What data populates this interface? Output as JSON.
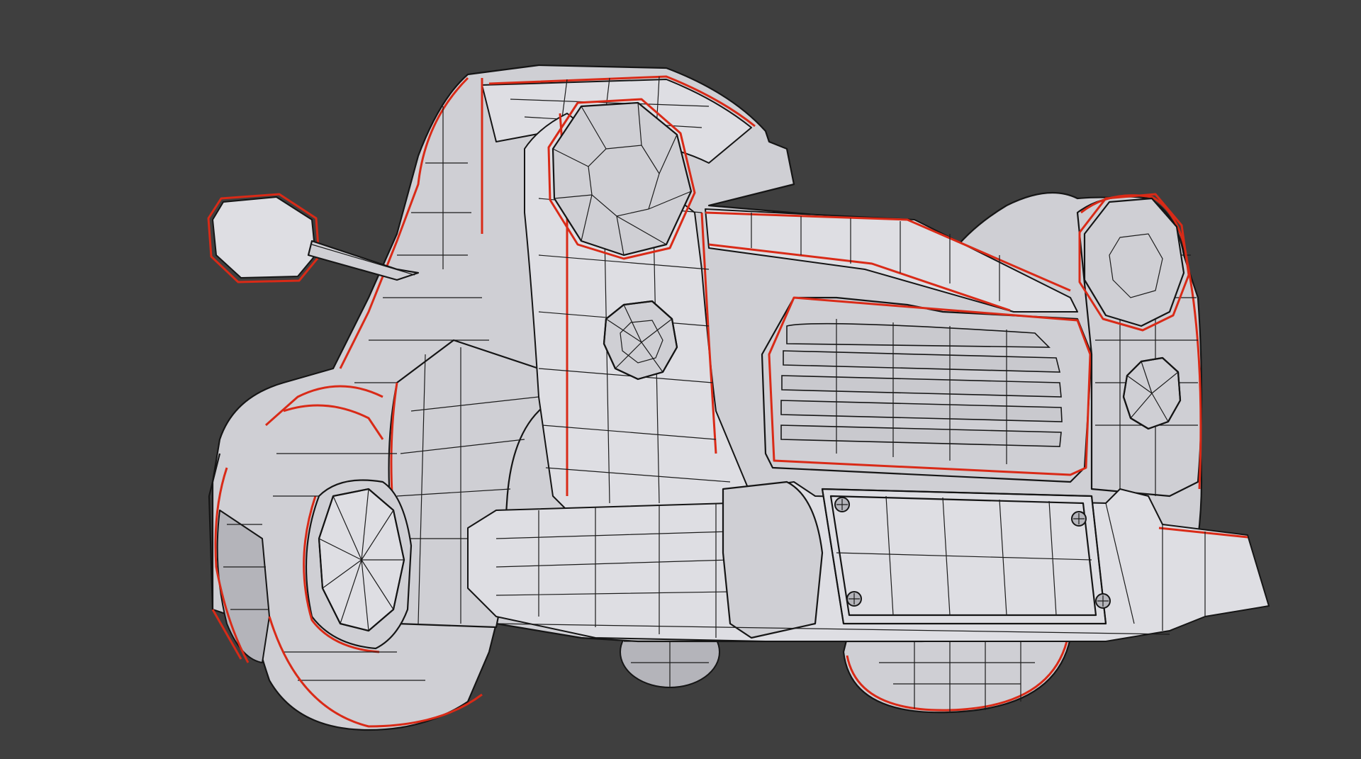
{
  "scene": {
    "description_name": "3d-viewport-wireframe-car",
    "background_color": "#3f3f3f",
    "mesh_color": "#cfcfd4",
    "seam_color": "#d92a17",
    "wire_color": "#1b1b1b"
  }
}
